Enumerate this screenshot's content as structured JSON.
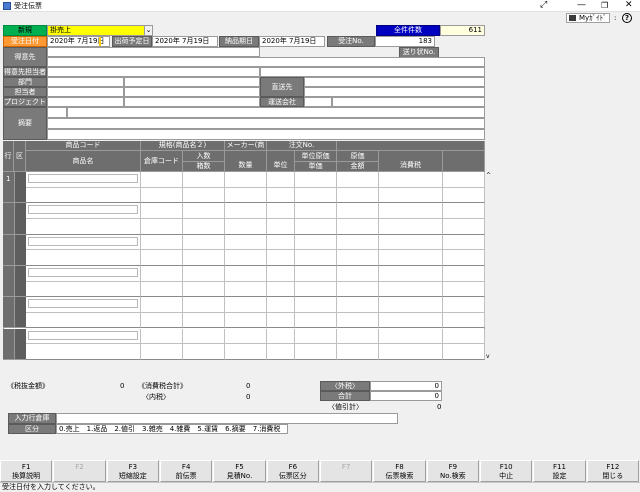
{
  "window": {
    "title": "受注伝票"
  },
  "toolbar": {
    "my_label": "Myｶﾞｲﾄﾞ",
    "help_label": "?"
  },
  "header": {
    "mode": "新規",
    "sales_type": "掛売上",
    "count_label": "全件件数",
    "count_value": "611",
    "order_date_label": "受注日付",
    "order_date": "2020年 7月19日",
    "order_day": "日",
    "ship_date_label": "出荷予定日",
    "ship_date": "2020年 7月19日",
    "delivery_date_label": "納品期日",
    "delivery_date": "2020年 7月19日",
    "order_no_label": "受注No.",
    "order_no": "183",
    "slip_no_label": "送り状No."
  },
  "fields": {
    "customer": "得意先",
    "customer_person": "得意先担当者",
    "department": "部門",
    "person": "担当者",
    "project": "プロジェクト",
    "summary": "摘要",
    "direct_ship": "直送先",
    "carrier": "運送会社"
  },
  "grid": {
    "row_label": "行",
    "kbn_label": "区",
    "headers": {
      "item_code": "商品コード",
      "item_name": "商品名",
      "spec": "規格(商品名２)",
      "maker": "メーカー(商",
      "order_no": "注文No.",
      "warehouse": "倉庫コード",
      "qty_per": "入数",
      "cases": "箱数",
      "quantity": "数量",
      "unit": "単位",
      "unit_cost": "単位原価",
      "unit_price": "単価",
      "cost": "原価",
      "amount": "金額",
      "tax": "消費税"
    },
    "first_row_no": "1"
  },
  "totals": {
    "pretax_label": "《税抜金額》",
    "pretax_value": "0",
    "tax_total_label": "《消費税合計》",
    "tax_total_value": "0",
    "inner_tax_label": "〈内税〉",
    "inner_tax_value": "0",
    "outer_tax_label": "〈外税〉",
    "outer_tax_value": "0",
    "total_label": "合計",
    "total_value": "0",
    "discount_label": "〈値引計〉",
    "discount_value": "0"
  },
  "footer": {
    "input_warehouse_label": "入力行倉庫",
    "kubun_label": "区分",
    "kubun_options": "0.売上　1.返品　2.値引　3.雑売　4.雑費　5.運賃　6.摘要　7.消費税"
  },
  "fkeys": [
    {
      "key": "F1",
      "label": "換算説明",
      "enabled": true
    },
    {
      "key": "F2",
      "label": "",
      "enabled": false
    },
    {
      "key": "F3",
      "label": "短縮設定",
      "enabled": true
    },
    {
      "key": "F4",
      "label": "前伝票",
      "enabled": true
    },
    {
      "key": "F5",
      "label": "見積No.",
      "enabled": true
    },
    {
      "key": "F6",
      "label": "伝票区分",
      "enabled": true
    },
    {
      "key": "F7",
      "label": "",
      "enabled": false
    },
    {
      "key": "F8",
      "label": "伝票検索",
      "enabled": true
    },
    {
      "key": "F9",
      "label": "No.検索",
      "enabled": true
    },
    {
      "key": "F10",
      "label": "中止",
      "enabled": true
    },
    {
      "key": "F11",
      "label": "設定",
      "enabled": true
    },
    {
      "key": "F12",
      "label": "閉じる",
      "enabled": true
    }
  ],
  "status": {
    "message": "受注日付を入力してください。"
  },
  "colors": {
    "mode_green": "#00b050",
    "sales_yellow": "#ffff00",
    "count_blue": "#0000c0",
    "order_date_orange": "#ff9933"
  }
}
